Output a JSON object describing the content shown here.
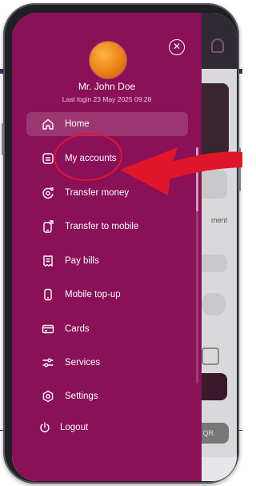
{
  "drawer": {
    "close_icon": "close-icon",
    "user": {
      "name": "Mr. John Doe",
      "last_login": "Last login  23 May 2025 09:28"
    },
    "menu": [
      {
        "label": "Home",
        "icon": "home-icon",
        "active": true
      },
      {
        "label": "My accounts",
        "icon": "accounts-icon",
        "active": false
      },
      {
        "label": "Transfer money",
        "icon": "transfer-money-icon",
        "active": false
      },
      {
        "label": "Transfer to mobile",
        "icon": "transfer-mobile-icon",
        "active": false
      },
      {
        "label": "Pay bills",
        "icon": "bill-icon",
        "active": false
      },
      {
        "label": "Mobile top-up",
        "icon": "mobile-topup-icon",
        "active": false
      },
      {
        "label": "Cards",
        "icon": "card-icon",
        "active": false
      },
      {
        "label": "Services",
        "icon": "services-icon",
        "active": false
      },
      {
        "label": "Settings",
        "icon": "settings-icon",
        "active": false
      },
      {
        "label": "Logout",
        "icon": "power-icon",
        "active": false
      }
    ]
  },
  "background_app": {
    "snippets": [
      "ment",
      "n QR"
    ]
  },
  "colors": {
    "drawer": "#8a1058",
    "annotation": "#e0162a"
  }
}
